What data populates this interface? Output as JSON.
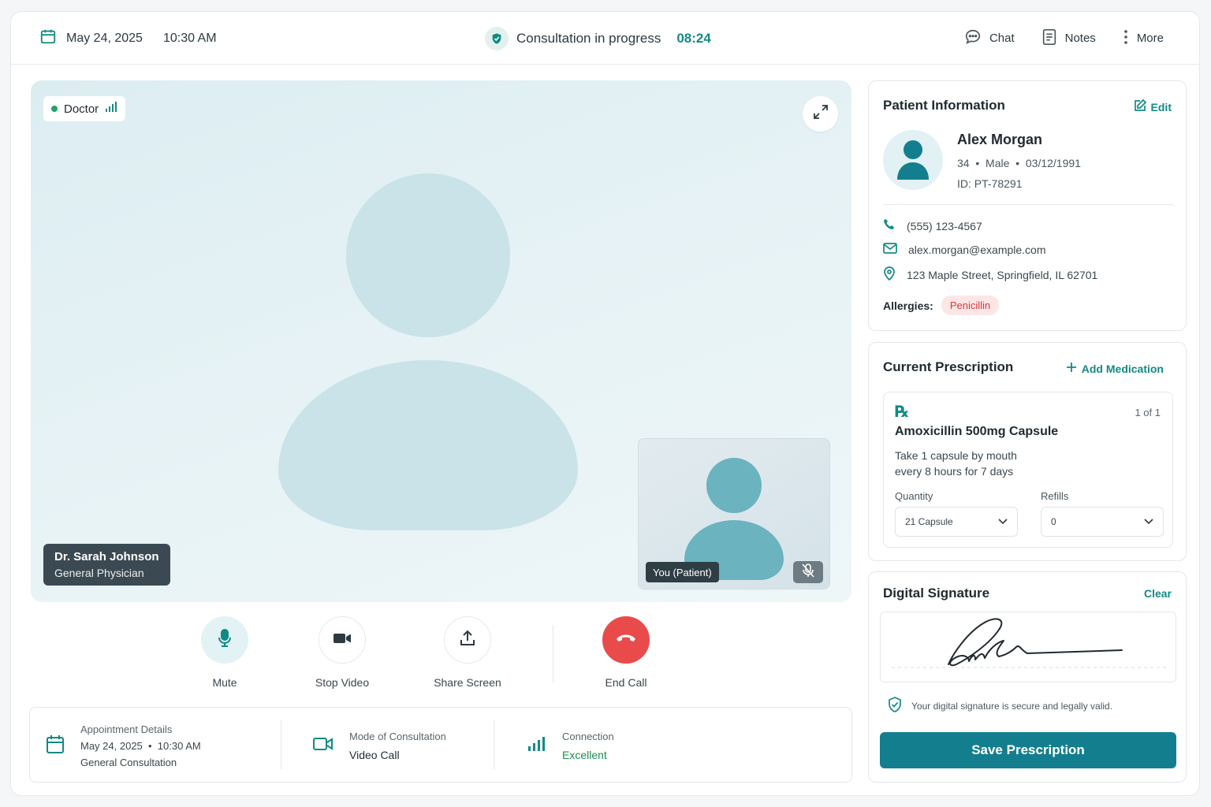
{
  "header": {
    "date": "May 24, 2025",
    "time": "10:30 AM",
    "status": "Consultation in progress",
    "timer": "08:24",
    "actions": {
      "chat": "Chat",
      "notes": "Notes",
      "more": "More"
    }
  },
  "video": {
    "doctor_tag": "Doctor",
    "doctor_name": "Dr. Sarah Johnson",
    "doctor_role": "General Physician",
    "self_label": "You (Patient)"
  },
  "controls": {
    "mute": "Mute",
    "stop_video": "Stop Video",
    "share_screen": "Share Screen",
    "end_call": "End Call"
  },
  "appointment": {
    "title": "Appointment Details",
    "date": "May 24, 2025",
    "time": "10:30 AM",
    "type": "General Consultation",
    "mode_title": "Mode of Consultation",
    "mode_value": "Video Call",
    "connection_title": "Connection",
    "connection_value": "Excellent"
  },
  "patient": {
    "section_title": "Patient Information",
    "edit_label": "Edit",
    "name": "Alex Morgan",
    "age": "34",
    "gender": "Male",
    "dob": "03/12/1991",
    "id": "ID: PT-78291",
    "phone": "(555) 123-4567",
    "email": "alex.morgan@example.com",
    "address": "123 Maple Street, Springfield, IL 62701",
    "allergies_label": "Allergies:",
    "allergy": "Penicillin"
  },
  "prescription": {
    "section_title": "Current Prescription",
    "add_label": "Add Medication",
    "rx_symbol": "℞",
    "count": "1 of 1",
    "med_name": "Amoxicillin 500mg Capsule",
    "directions": "Take 1 capsule by mouth every 8 hours for 7 days",
    "quantity_label": "Quantity",
    "quantity_value": "21 Capsule",
    "refills_label": "Refills",
    "refills_value": "0"
  },
  "signature": {
    "section_title": "Digital Signature",
    "clear_label": "Clear",
    "note": "Your digital signature is secure and legally valid.",
    "save_label": "Save Prescription"
  },
  "colors": {
    "accent": "#128a84",
    "primary_button": "#137f8e",
    "end_call": "#e94b4b",
    "success": "#1a8f4e",
    "allergy": "#d23b3b"
  },
  "icons": {
    "calendar": "calendar-icon",
    "status": "shield-check-icon",
    "chat": "chat-bubble-icon",
    "notes": "notes-icon",
    "more": "more-vertical-icon",
    "signal": "signal-icon",
    "expand": "expand-icon",
    "mic_off": "mic-off-icon",
    "mic": "mic-icon",
    "video": "video-camera-icon",
    "share": "share-upload-icon",
    "end_call": "phone-hangup-icon",
    "phone": "phone-icon",
    "email": "mail-icon",
    "location": "location-pin-icon",
    "edit": "edit-icon",
    "add": "plus-icon",
    "chevron": "chevron-down-icon",
    "secure": "shield-check-icon"
  }
}
